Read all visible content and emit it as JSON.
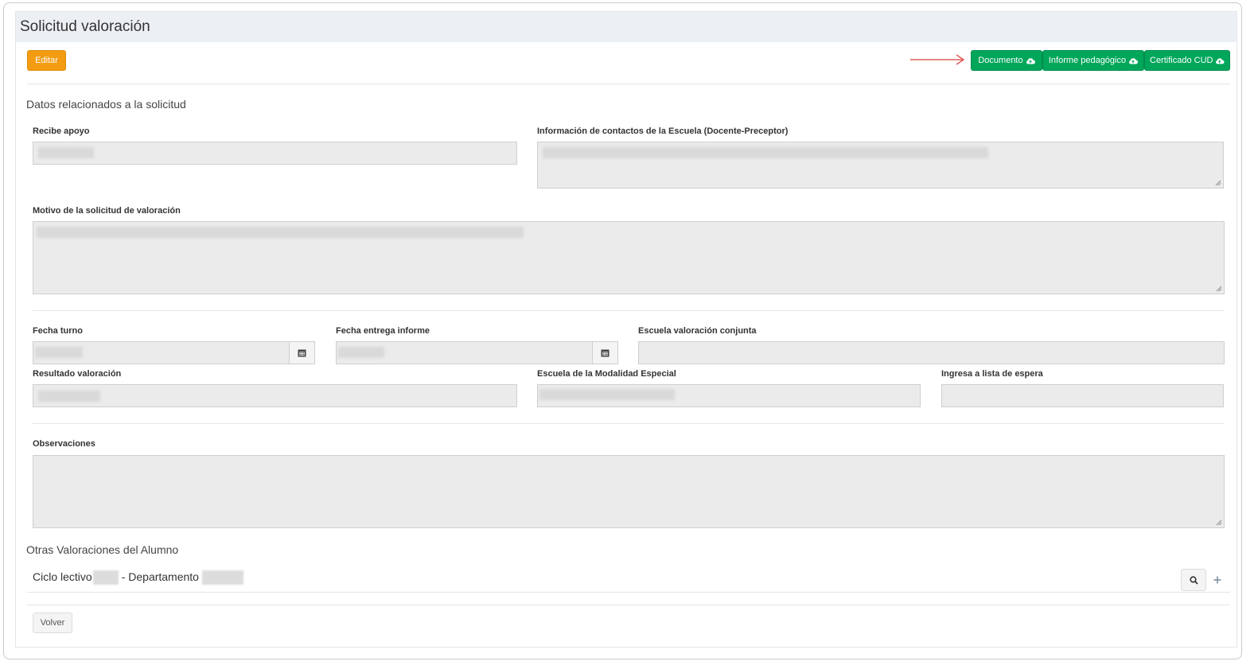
{
  "panel": {
    "title": "Solicitud valoración"
  },
  "toolbar": {
    "edit_label": "Editar",
    "documento_label": "Documento",
    "informe_label": "Informe pedagógico",
    "certificado_label": "Certificado CUD"
  },
  "section1": {
    "title": "Datos relacionados a la solicitud",
    "recibe_apoyo_label": "Recibe apoyo",
    "contactos_label": "Información de contactos de la Escuela (Docente-Preceptor)",
    "motivo_label": "Motivo de la solicitud de valoración"
  },
  "section2": {
    "fecha_turno_label": "Fecha turno",
    "fecha_entrega_label": "Fecha entrega informe",
    "escuela_conjunta_label": "Escuela valoración conjunta",
    "resultado_label": "Resultado valoración",
    "escuela_modalidad_label": "Escuela de la Modalidad Especial",
    "lista_espera_label": "Ingresa a lista de espera"
  },
  "section3": {
    "observaciones_label": "Observaciones"
  },
  "otras": {
    "title": "Otras Valoraciones del Alumno",
    "ciclo_label": "Ciclo lectivo",
    "departamento_label": "- Departamento"
  },
  "footer": {
    "volver_label": "Volver"
  },
  "icons": {
    "calendar": "calendar-icon",
    "cloud_upload": "cloud-upload-icon",
    "search": "search-icon",
    "plus": "plus-icon",
    "arrow": "arrow-right-icon"
  },
  "colors": {
    "edit": "#f39c12",
    "green": "#00a65a",
    "arrow": "#e05a5a",
    "field_bg": "#ebebeb"
  }
}
